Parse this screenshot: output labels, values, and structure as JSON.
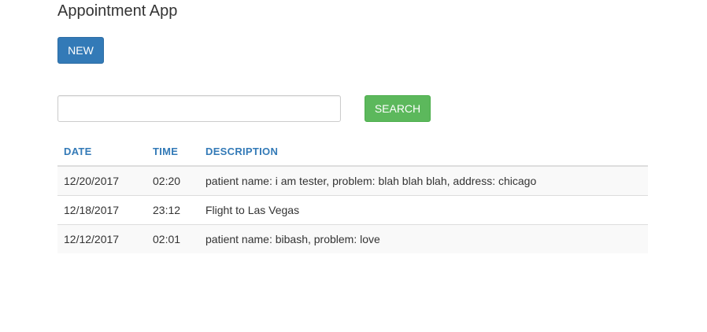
{
  "app": {
    "title": "Appointment App"
  },
  "toolbar": {
    "new_label": "NEW"
  },
  "search": {
    "value": "",
    "placeholder": "",
    "button_label": "SEARCH"
  },
  "table": {
    "columns": [
      "DATE",
      "TIME",
      "DESCRIPTION"
    ],
    "rows": [
      {
        "date": "12/20/2017",
        "time": "02:20",
        "description": "patient name: i am tester, problem: blah blah blah, address: chicago"
      },
      {
        "date": "12/18/2017",
        "time": "23:12",
        "description": "Flight to Las Vegas"
      },
      {
        "date": "12/12/2017",
        "time": "02:01",
        "description": "patient name: bibash, problem: love"
      }
    ]
  },
  "colors": {
    "primary": "#337ab7",
    "success": "#5cb85c",
    "stripe": "#f9f9f9",
    "border": "#dddddd",
    "text": "#333333"
  }
}
